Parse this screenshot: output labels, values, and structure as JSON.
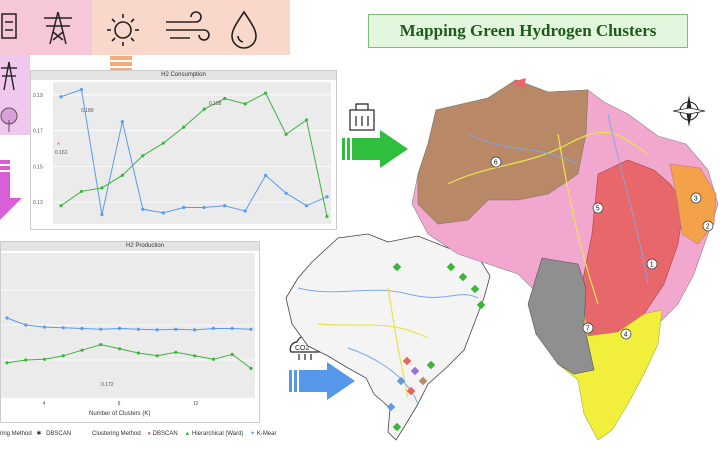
{
  "title": "Mapping Green Hydrogen Clusters",
  "icons": [
    "battery-icon",
    "power-tower-icon",
    "sun-icon",
    "wind-icon",
    "water-drop-icon",
    "power-tower-icon-2",
    "tree-icon",
    "electrolyzer-icon",
    "co2-cloud-icon",
    "compass-icon"
  ],
  "colors": {
    "dbscan": "#e8635a",
    "hierarchical": "#3cb43c",
    "kmeans": "#5b9bea",
    "cluster_pink": "#f2a7cf",
    "cluster_brown": "#b98967",
    "cluster_red": "#e8676b",
    "cluster_orange": "#f4a24a",
    "cluster_yellow": "#f2ee3c",
    "cluster_gray": "#8f8f8f",
    "arrow_green": "#2fbf3c",
    "arrow_blue": "#5597ea",
    "arrow_peach": "#f6ab7a",
    "arrow_magenta": "#d85fd8"
  },
  "top_chart": {
    "title": "H2 Consumption",
    "y_ticks": [
      "0.19",
      "0.17",
      "0.15",
      "0.13"
    ],
    "annotations": {
      "kmeans": "0.189",
      "hierarchical": "0.188",
      "dbscan": "0.161"
    }
  },
  "bottom_chart": {
    "title": "H2 Production",
    "x_label": "Number of Clusters (K)",
    "x_ticks": [
      "4",
      "8",
      "12"
    ],
    "annotation": "0.172"
  },
  "legend_left": {
    "label": "ring Method",
    "item": "DBSCAN"
  },
  "legend_main": {
    "label": "Clustering Method",
    "items": [
      "DBSCAN",
      "Hierarchical (Ward)",
      "K-Mear"
    ]
  },
  "cluster_labels": [
    "1",
    "2",
    "3",
    "4",
    "5",
    "6",
    "7"
  ],
  "chart_data": [
    {
      "type": "line",
      "title": "H2 Consumption",
      "x": [
        2,
        3,
        4,
        5,
        6,
        7,
        8,
        9,
        10,
        11,
        12,
        13,
        14,
        15
      ],
      "ylim": [
        0.12,
        0.195
      ],
      "series": [
        {
          "name": "K-Mear",
          "values": [
            0.189,
            0.193,
            0.123,
            0.175,
            0.126,
            0.124,
            0.127,
            0.127,
            0.128,
            0.125,
            0.145,
            0.135,
            0.128,
            0.133
          ]
        },
        {
          "name": "Hierarchical (Ward)",
          "values": [
            0.128,
            0.136,
            0.138,
            0.145,
            0.156,
            0.163,
            0.172,
            0.182,
            0.188,
            0.185,
            0.191,
            0.168,
            0.176,
            0.122
          ]
        },
        {
          "name": "DBSCAN",
          "values": [
            0.161
          ]
        }
      ]
    },
    {
      "type": "line",
      "title": "H2 Production",
      "xlabel": "Number of Clusters (K)",
      "x": [
        2,
        3,
        4,
        5,
        6,
        7,
        8,
        9,
        10,
        11,
        12,
        13,
        14,
        15
      ],
      "ylim": [
        0.1,
        0.3
      ],
      "series": [
        {
          "name": "K-Mear",
          "values": [
            0.21,
            0.2,
            0.197,
            0.196,
            0.195,
            0.194,
            0.195,
            0.194,
            0.193,
            0.194,
            0.193,
            0.195,
            0.195,
            0.194
          ]
        },
        {
          "name": "Hierarchical (Ward)",
          "values": [
            0.146,
            0.15,
            0.151,
            0.156,
            0.164,
            0.172,
            0.166,
            0.16,
            0.156,
            0.161,
            0.156,
            0.151,
            0.158,
            0.138
          ]
        }
      ]
    }
  ]
}
